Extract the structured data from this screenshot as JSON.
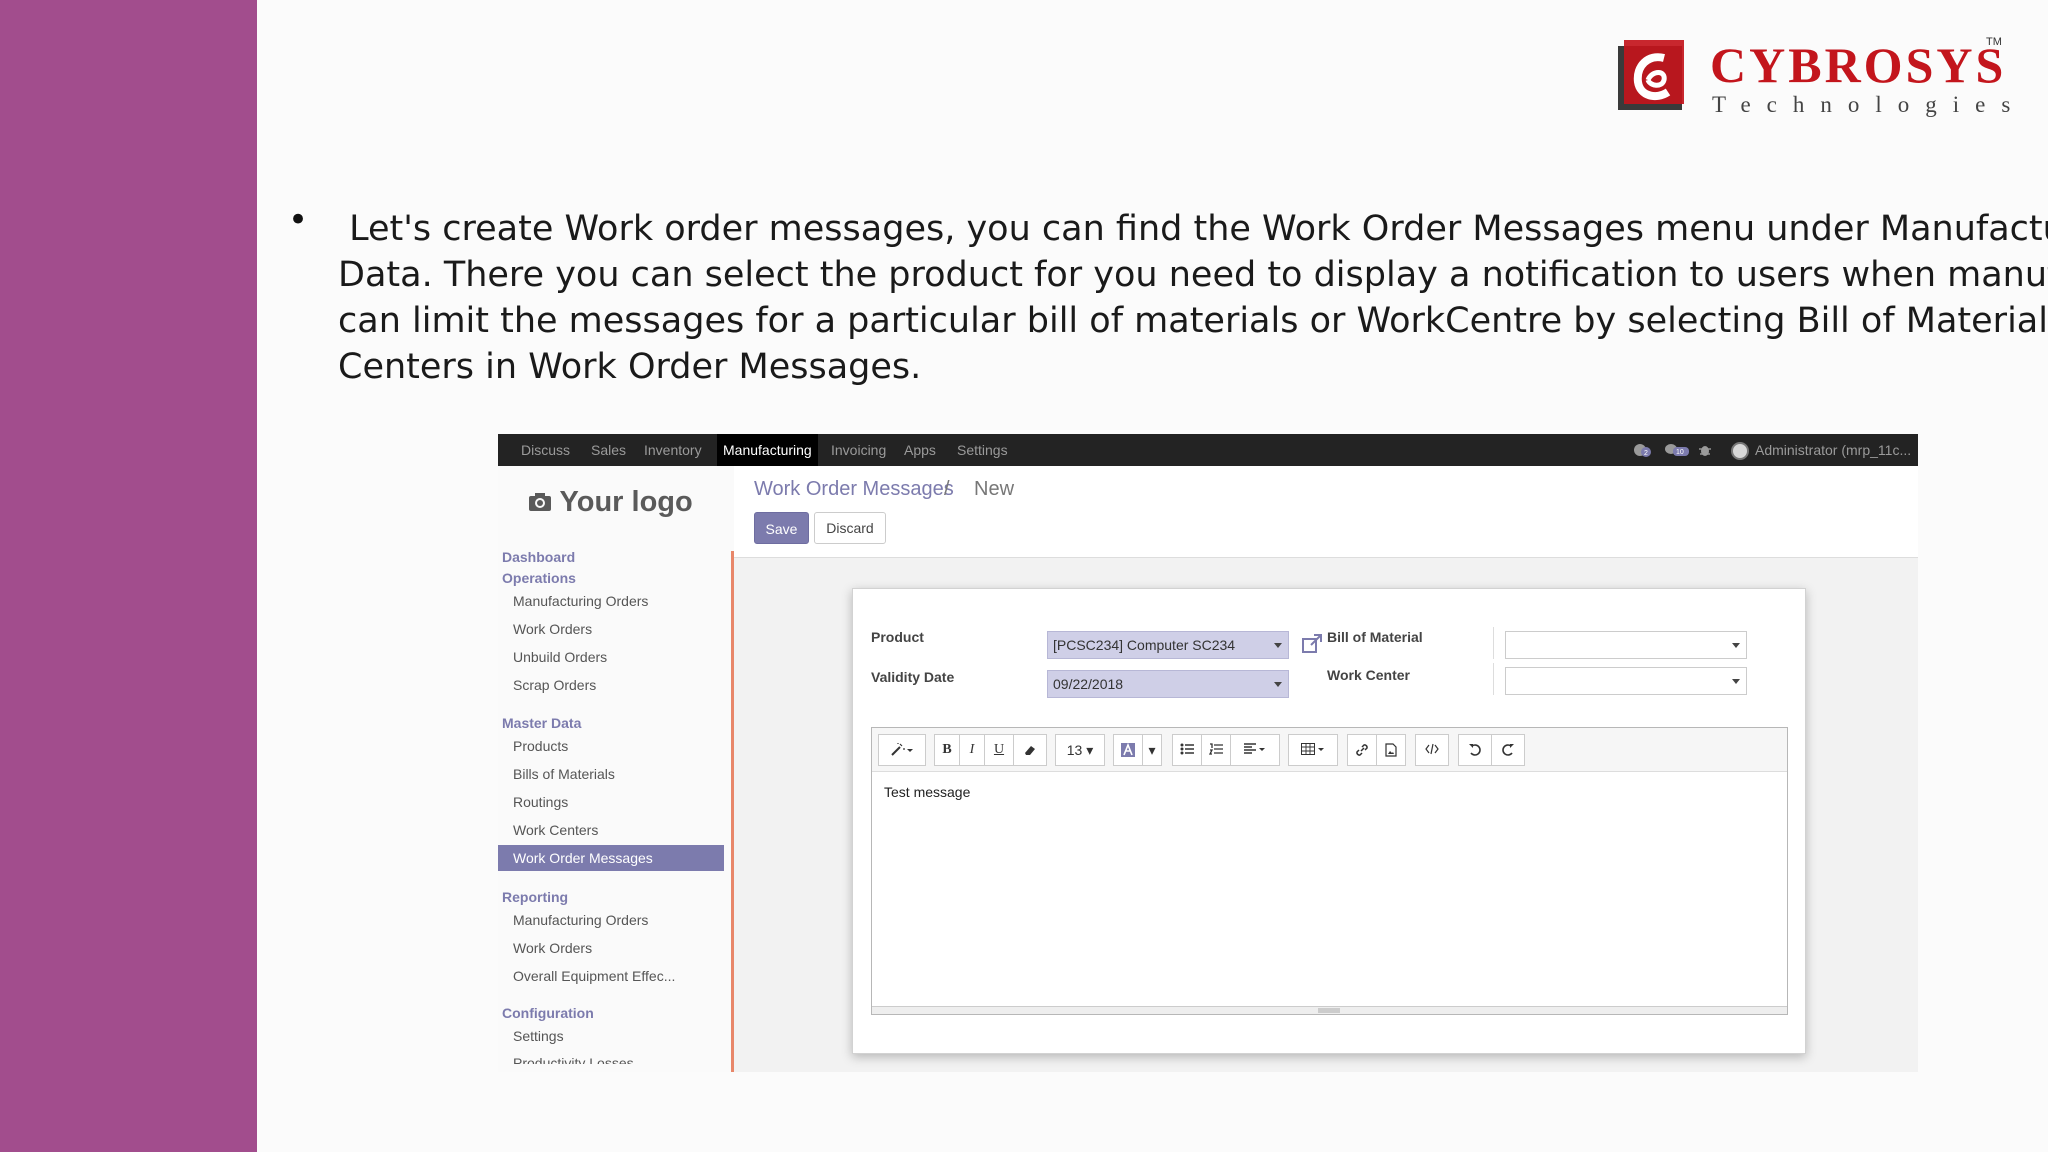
{
  "brand": {
    "name": "CYBROSYS",
    "trademark": "TM",
    "subtitle": "Technologies",
    "colors": {
      "red": "#c3151c",
      "dark": "#3a3a3a",
      "band": "#a24d8d",
      "accent": "#7c7bad"
    }
  },
  "bullet": {
    "lines": [
      " Let's create Work order messages, you can find the Work Order Messages menu under Manufacturing > Master",
      "Data. There you can select the product for you need to display a notification to users when manufacturing. You",
      "can limit the messages for a particular bill of materials or WorkCentre by selecting Bill of Materials or Work",
      "Centers in Work Order Messages."
    ]
  },
  "odoo": {
    "menu": [
      "Discuss",
      "Sales",
      "Inventory",
      "Manufacturing",
      "Invoicing",
      "Apps",
      "Settings"
    ],
    "active_menu": "Manufacturing",
    "topbar_icons": [
      "chat-bubble-icon",
      "messages-icon",
      "bug-icon"
    ],
    "topbar_badges": [
      "2",
      "10"
    ],
    "user": "Administrator (mrp_11c...",
    "company_logo_text": "Your logo",
    "sidebar": {
      "dashboard": "Dashboard",
      "operations": {
        "title": "Operations",
        "items": [
          "Manufacturing Orders",
          "Work Orders",
          "Unbuild Orders",
          "Scrap Orders"
        ]
      },
      "master_data": {
        "title": "Master Data",
        "items": [
          "Products",
          "Bills of Materials",
          "Routings",
          "Work Centers",
          "Work Order Messages"
        ],
        "selected": "Work Order Messages"
      },
      "reporting": {
        "title": "Reporting",
        "items": [
          "Manufacturing Orders",
          "Work Orders",
          "Overall Equipment Effec..."
        ]
      },
      "configuration": {
        "title": "Configuration",
        "items": [
          "Settings",
          "Productivity Losses"
        ]
      }
    },
    "breadcrumb": {
      "parent": "Work Order Messages",
      "separator": "/",
      "current": "New"
    },
    "buttons": {
      "save": "Save",
      "discard": "Discard"
    },
    "form": {
      "product_label": "Product",
      "product_value": "[PCSC234] Computer SC234",
      "validity_label": "Validity Date",
      "validity_value": "09/22/2018",
      "bom_label": "Bill of Material",
      "bom_value": "",
      "workcenter_label": "Work Center",
      "workcenter_value": ""
    },
    "editor": {
      "font_size": "13",
      "toolbar_icons": [
        "magic-wand-icon",
        "bold-icon",
        "italic-icon",
        "underline-icon",
        "eraser-icon",
        "font-size-dropdown",
        "font-color-icon",
        "unordered-list-icon",
        "ordered-list-icon",
        "align-icon",
        "table-icon",
        "link-icon",
        "image-icon",
        "code-view-icon",
        "undo-icon",
        "redo-icon"
      ],
      "content": "Test message"
    }
  }
}
